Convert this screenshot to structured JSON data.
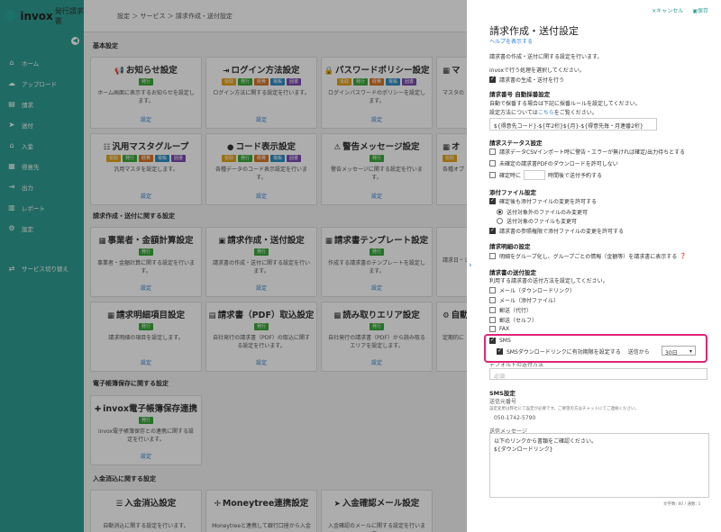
{
  "app": {
    "name": "invox",
    "subtitle": "発行請求書"
  },
  "breadcrumb": "設定 ＞ サービス ＞ 請求作成・送付設定",
  "sidebar": {
    "items": [
      {
        "icon": "⌂",
        "label": "ホーム"
      },
      {
        "icon": "☁",
        "label": "アップロード"
      },
      {
        "icon": "▤",
        "label": "請求"
      },
      {
        "icon": "➤",
        "label": "送付"
      },
      {
        "icon": "⌂",
        "label": "入金"
      },
      {
        "icon": "▦",
        "label": "得意先"
      },
      {
        "icon": "⇥",
        "label": "出力"
      },
      {
        "icon": "▥",
        "label": "レポート"
      },
      {
        "icon": "⚙",
        "label": "設定"
      }
    ],
    "switch_label": "サービス切り替え"
  },
  "tag_colors": {
    "受取": "#e5a21b",
    "発行": "#3aa93a",
    "経費": "#d9731f",
    "電帳": "#2c8fc4",
    "囲書": "#7b4ab0"
  },
  "sections": {
    "basic": "基本設定",
    "invoice": "請求作成・送付に関する設定",
    "storage": "電子帳簿保存に関する設定",
    "payment": "入金消込に関する設定"
  },
  "cards": [
    {
      "icon": "📢",
      "title": "お知らせ設定",
      "tags": [
        "発行"
      ],
      "desc": "ホーム画面に表示するお知らせを設定します。",
      "link": "設定"
    },
    {
      "icon": "⇥",
      "title": "ログイン方法設定",
      "tags": [
        "受取",
        "発行",
        "経費",
        "電帳",
        "囲書"
      ],
      "desc": "ログイン方法に関する設定を行います。",
      "link": "設定"
    },
    {
      "icon": "🔒",
      "title": "パスワードポリシー設定",
      "tags": [
        "受取",
        "発行",
        "経費",
        "電帳",
        "囲書"
      ],
      "desc": "ログインパスワードのポリシーを設定します。",
      "link": "設定"
    },
    {
      "icon": "▦",
      "title": "マ",
      "tags": [],
      "desc": "マスタの",
      "link": ""
    },
    {
      "icon": "☷",
      "title": "汎用マスタグループ",
      "tags": [
        "受取",
        "発行",
        "経費",
        "電帳",
        "囲書"
      ],
      "desc": "汎用マスタを設定します。",
      "link": "設定"
    },
    {
      "icon": "●",
      "title": "コード表示設定",
      "tags": [
        "受取",
        "発行",
        "経費",
        "電帳",
        "囲書"
      ],
      "desc": "各種データのコード表示設定を行います。",
      "link": "設定"
    },
    {
      "icon": "⚠",
      "title": "警告メッセージ設定",
      "tags": [
        "発行"
      ],
      "desc": "警告メッセージに関する設定を行います。",
      "link": "設定"
    },
    {
      "icon": "▦",
      "title": "オ",
      "tags": [
        "受取"
      ],
      "desc": "各種オプ",
      "link": ""
    },
    {
      "icon": "▦",
      "title": "事業者・金額計算設定",
      "tags": [
        "発行"
      ],
      "desc": "事業者・金額計算に関する設定を行います。",
      "link": "設定"
    },
    {
      "icon": "▣",
      "title": "請求作成・送付設定",
      "tags": [
        "発行"
      ],
      "desc": "請求書の作成・送付に関する設定を行います。",
      "link": "設定"
    },
    {
      "icon": "▦",
      "title": "請求書テンプレート設定",
      "tags": [
        "発行"
      ],
      "desc": "作成する請求書のテンプレートを設定します。",
      "link": "設定"
    },
    {
      "icon": "",
      "title": "",
      "tags": [],
      "desc": "請求日・ジ",
      "link": ""
    },
    {
      "icon": "▦",
      "title": "請求明細項目設定",
      "tags": [
        "発行"
      ],
      "desc": "請求明細の項目を設定します。",
      "link": "設定"
    },
    {
      "icon": "▤",
      "title": "請求書（PDF）取込設定",
      "tags": [
        "発行"
      ],
      "desc": "自社発行の請求書（PDF）の取込に関する設定を行います。",
      "link": "設定"
    },
    {
      "icon": "▦",
      "title": "読み取りエリア設定",
      "tags": [
        "発行"
      ],
      "desc": "自社発行の請求書（PDF）から読み取るエリアを設定します。",
      "link": "設定"
    },
    {
      "icon": "⚙",
      "title": "自動",
      "tags": [],
      "desc": "定期的に",
      "link": ""
    },
    {
      "icon": "✚",
      "title": "invox電子帳簿保存連携",
      "tags": [
        "発行"
      ],
      "desc": "invox電子帳簿保存との連携に関する設定を行います。",
      "link": "設定"
    },
    {
      "icon": "☰",
      "title": "入金消込設定",
      "tags": [],
      "desc": "自動消込に関する設定を行います。",
      "link": ""
    },
    {
      "icon": "✢",
      "title": "Moneytree連携設定",
      "tags": [],
      "desc": "Moneytreeと連携して銀行口座から入金",
      "link": ""
    },
    {
      "icon": "➤",
      "title": "入金確認メール設定",
      "tags": [],
      "desc": "入金確認のメールに関する設定を行います。",
      "link": ""
    }
  ],
  "panel": {
    "cancel": "キャンセル",
    "save": "保存",
    "title": "請求作成・送付設定",
    "help": "ヘルプを表示する",
    "intro": "請求書の作成・送付に関する設定を行います。",
    "process_note": "invoxで行う処理を選択してください。",
    "process_opt": "請求書の生成・送付を行う",
    "numbering_title": "請求番号 自動採番設定",
    "numbering_desc1": "自動で採番する場合は下記に採番ルールを設定してください。",
    "numbering_desc2a": "設定方法については",
    "numbering_link": "こちら",
    "numbering_desc2b": "をご覧ください。",
    "numbering_value": "${得意先コード}-${年2桁}${月}-${得意先毎・月連番2桁}",
    "status_title": "請求ステータス設定",
    "status_opts": [
      "請求データCSVインポート時に警告・エラーが無ければ確定/出力待ちとする",
      "未確定の請求書PDFのダウンロードを許可しない"
    ],
    "status_confirm_a": "確定時に",
    "status_confirm_b": "時間後で送付予約する",
    "attach_title": "添付ファイル設定",
    "attach_opt1": "確定後も添付ファイルの変更を許可する",
    "attach_radio1": "送付対象外のファイルのみ変更可",
    "attach_radio2": "送付対象のファイルも変更可",
    "attach_opt2": "請求書の参照権限で添付ファイルの変更を許可する",
    "detail_title": "請求明細の設定",
    "detail_opt": "明細をグループ化し、グループごとの情報（金額等）を請求書に表示する",
    "send_title": "請求書の送付設定",
    "send_desc": "利用する請求書の送付方法を設定してください。",
    "send_opts": [
      "メール（ダウンロードリンク）",
      "メール（添付ファイル）",
      "郵送（代行）",
      "郵送（セルフ）",
      "FAX"
    ],
    "sms_label": "SMS",
    "sms_expiry_label": "SMSダウンロードリンクに有効期限を設定する",
    "sms_from_label": "送信から",
    "sms_expiry_value": "30日",
    "default_method_label": "デフォルトの送付方法",
    "default_method_value": "必須",
    "sms_settings_title": "SMS設定",
    "sender_label": "送信元番号",
    "sender_note": "設定変更は弊社にて設定が必要です。ご要望の方はチャットにてご連絡ください。",
    "sender_number": "050-1742-5790",
    "message_label": "送信メッセージ",
    "message_line1": "以下のリンクから書類をご確認ください。",
    "message_line2": "${ダウンロードリンク}",
    "char_count": "文字数: 60 / 通数: 1"
  }
}
